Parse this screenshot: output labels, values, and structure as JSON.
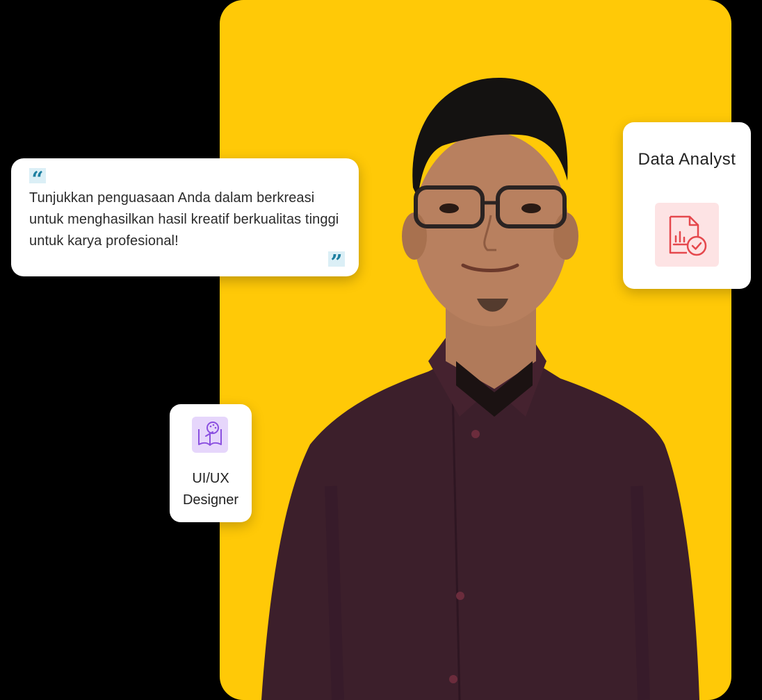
{
  "quote": {
    "open_mark": "“",
    "text": "Tunjukkan penguasaan Anda dalam berkreasi untuk menghasilkan hasil kreatif berkualitas tinggi untuk karya profesional!",
    "close_mark": "”"
  },
  "roles": [
    {
      "title": "Data Analyst",
      "icon": "document-chart-check-icon",
      "icon_bg": "#fde3e4",
      "icon_color": "#e5484d"
    },
    {
      "title": "UI/UX Designer",
      "icon": "book-palette-icon",
      "icon_bg": "#e6d6fb",
      "icon_color": "#8a4fe0"
    }
  ],
  "colors": {
    "background": "#000000",
    "panel": "#ffc907",
    "card": "#ffffff",
    "quote_accent": "#1d7fa0"
  }
}
